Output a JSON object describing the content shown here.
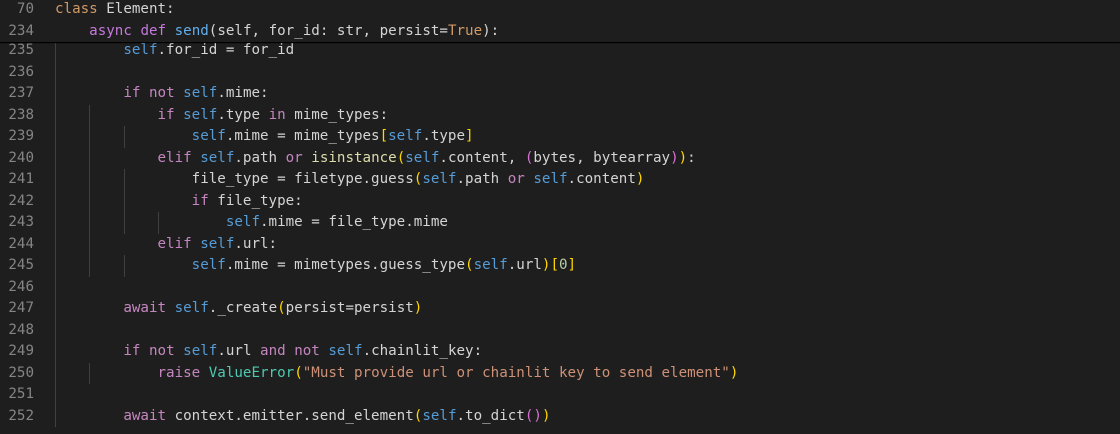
{
  "sticky": [
    {
      "num": "70",
      "tokens": [
        {
          "t": "class",
          "c": "sticky-kw"
        },
        {
          "t": " Element:",
          "c": "sticky-tx"
        }
      ]
    },
    {
      "num": "234",
      "tokens": [
        {
          "t": "    ",
          "c": "tx"
        },
        {
          "t": "async",
          "c": "sticky-kw2"
        },
        {
          "t": " ",
          "c": "tx"
        },
        {
          "t": "def",
          "c": "sticky-kw2"
        },
        {
          "t": " ",
          "c": "tx"
        },
        {
          "t": "send",
          "c": "sticky-fn"
        },
        {
          "t": "(self, for_id: str, persist=",
          "c": "sticky-tx"
        },
        {
          "t": "True",
          "c": "sticky-kw"
        },
        {
          "t": "):",
          "c": "sticky-tx"
        }
      ]
    }
  ],
  "lines": [
    {
      "num": "235",
      "guides": [
        1
      ],
      "tokens": [
        {
          "t": "        ",
          "c": "tx"
        },
        {
          "t": "self",
          "c": "self"
        },
        {
          "t": ".for_id = for_id",
          "c": "tx"
        }
      ]
    },
    {
      "num": "236",
      "guides": [
        1
      ],
      "tokens": []
    },
    {
      "num": "237",
      "guides": [
        1
      ],
      "tokens": [
        {
          "t": "        ",
          "c": "tx"
        },
        {
          "t": "if",
          "c": "ctl"
        },
        {
          "t": " ",
          "c": "tx"
        },
        {
          "t": "not",
          "c": "ctl"
        },
        {
          "t": " ",
          "c": "tx"
        },
        {
          "t": "self",
          "c": "self"
        },
        {
          "t": ".mime:",
          "c": "tx"
        }
      ]
    },
    {
      "num": "238",
      "guides": [
        1,
        2
      ],
      "tokens": [
        {
          "t": "            ",
          "c": "tx"
        },
        {
          "t": "if",
          "c": "ctl"
        },
        {
          "t": " ",
          "c": "tx"
        },
        {
          "t": "self",
          "c": "self"
        },
        {
          "t": ".type ",
          "c": "tx"
        },
        {
          "t": "in",
          "c": "ctl"
        },
        {
          "t": " mime_types:",
          "c": "tx"
        }
      ]
    },
    {
      "num": "239",
      "guides": [
        1,
        2,
        3
      ],
      "tokens": [
        {
          "t": "                ",
          "c": "tx"
        },
        {
          "t": "self",
          "c": "self"
        },
        {
          "t": ".mime = mime_types",
          "c": "tx"
        },
        {
          "t": "[",
          "c": "b1"
        },
        {
          "t": "self",
          "c": "self"
        },
        {
          "t": ".type",
          "c": "tx"
        },
        {
          "t": "]",
          "c": "b1"
        }
      ]
    },
    {
      "num": "240",
      "guides": [
        1,
        2
      ],
      "tokens": [
        {
          "t": "            ",
          "c": "tx"
        },
        {
          "t": "elif",
          "c": "ctl"
        },
        {
          "t": " ",
          "c": "tx"
        },
        {
          "t": "self",
          "c": "self"
        },
        {
          "t": ".path ",
          "c": "tx"
        },
        {
          "t": "or",
          "c": "ctl"
        },
        {
          "t": " ",
          "c": "tx"
        },
        {
          "t": "isinstance",
          "c": "fn"
        },
        {
          "t": "(",
          "c": "b1"
        },
        {
          "t": "self",
          "c": "self"
        },
        {
          "t": ".content, ",
          "c": "tx"
        },
        {
          "t": "(",
          "c": "b2"
        },
        {
          "t": "bytes, bytearray",
          "c": "tx"
        },
        {
          "t": ")",
          "c": "b2"
        },
        {
          "t": ")",
          "c": "b1"
        },
        {
          "t": ":",
          "c": "tx"
        }
      ]
    },
    {
      "num": "241",
      "guides": [
        1,
        2,
        3
      ],
      "tokens": [
        {
          "t": "                ",
          "c": "tx"
        },
        {
          "t": "file_type = filetype.guess",
          "c": "tx"
        },
        {
          "t": "(",
          "c": "b1"
        },
        {
          "t": "self",
          "c": "self"
        },
        {
          "t": ".path ",
          "c": "tx"
        },
        {
          "t": "or",
          "c": "ctl"
        },
        {
          "t": " ",
          "c": "tx"
        },
        {
          "t": "self",
          "c": "self"
        },
        {
          "t": ".content",
          "c": "tx"
        },
        {
          "t": ")",
          "c": "b1"
        }
      ]
    },
    {
      "num": "242",
      "guides": [
        1,
        2,
        3
      ],
      "tokens": [
        {
          "t": "                ",
          "c": "tx"
        },
        {
          "t": "if",
          "c": "ctl"
        },
        {
          "t": " file_type:",
          "c": "tx"
        }
      ]
    },
    {
      "num": "243",
      "guides": [
        1,
        2,
        3,
        4
      ],
      "tokens": [
        {
          "t": "                    ",
          "c": "tx"
        },
        {
          "t": "self",
          "c": "self"
        },
        {
          "t": ".mime = file_type.mime",
          "c": "tx"
        }
      ]
    },
    {
      "num": "244",
      "guides": [
        1,
        2
      ],
      "tokens": [
        {
          "t": "            ",
          "c": "tx"
        },
        {
          "t": "elif",
          "c": "ctl"
        },
        {
          "t": " ",
          "c": "tx"
        },
        {
          "t": "self",
          "c": "self"
        },
        {
          "t": ".url:",
          "c": "tx"
        }
      ]
    },
    {
      "num": "245",
      "guides": [
        1,
        2,
        3
      ],
      "tokens": [
        {
          "t": "                ",
          "c": "tx"
        },
        {
          "t": "self",
          "c": "self"
        },
        {
          "t": ".mime = mimetypes.guess_type",
          "c": "tx"
        },
        {
          "t": "(",
          "c": "b1"
        },
        {
          "t": "self",
          "c": "self"
        },
        {
          "t": ".url",
          "c": "tx"
        },
        {
          "t": ")",
          "c": "b1"
        },
        {
          "t": "[",
          "c": "b1"
        },
        {
          "t": "0",
          "c": "num"
        },
        {
          "t": "]",
          "c": "b1"
        }
      ]
    },
    {
      "num": "246",
      "guides": [
        1
      ],
      "tokens": []
    },
    {
      "num": "247",
      "guides": [
        1
      ],
      "tokens": [
        {
          "t": "        ",
          "c": "tx"
        },
        {
          "t": "await",
          "c": "ctl"
        },
        {
          "t": " ",
          "c": "tx"
        },
        {
          "t": "self",
          "c": "self"
        },
        {
          "t": "._create",
          "c": "tx"
        },
        {
          "t": "(",
          "c": "b1"
        },
        {
          "t": "persist=persist",
          "c": "tx"
        },
        {
          "t": ")",
          "c": "b1"
        }
      ]
    },
    {
      "num": "248",
      "guides": [
        1
      ],
      "tokens": []
    },
    {
      "num": "249",
      "guides": [
        1
      ],
      "tokens": [
        {
          "t": "        ",
          "c": "tx"
        },
        {
          "t": "if",
          "c": "ctl"
        },
        {
          "t": " ",
          "c": "tx"
        },
        {
          "t": "not",
          "c": "ctl"
        },
        {
          "t": " ",
          "c": "tx"
        },
        {
          "t": "self",
          "c": "self"
        },
        {
          "t": ".url ",
          "c": "tx"
        },
        {
          "t": "and",
          "c": "ctl"
        },
        {
          "t": " ",
          "c": "tx"
        },
        {
          "t": "not",
          "c": "ctl"
        },
        {
          "t": " ",
          "c": "tx"
        },
        {
          "t": "self",
          "c": "self"
        },
        {
          "t": ".chainlit_key:",
          "c": "tx"
        }
      ]
    },
    {
      "num": "250",
      "guides": [
        1,
        2
      ],
      "tokens": [
        {
          "t": "            ",
          "c": "tx"
        },
        {
          "t": "raise",
          "c": "ctl"
        },
        {
          "t": " ",
          "c": "tx"
        },
        {
          "t": "ValueError",
          "c": "cls"
        },
        {
          "t": "(",
          "c": "b1"
        },
        {
          "t": "\"Must provide url or chainlit key to send element\"",
          "c": "str"
        },
        {
          "t": ")",
          "c": "b1"
        }
      ]
    },
    {
      "num": "251",
      "guides": [
        1
      ],
      "tokens": []
    },
    {
      "num": "252",
      "guides": [
        1
      ],
      "tokens": [
        {
          "t": "        ",
          "c": "tx"
        },
        {
          "t": "await",
          "c": "ctl"
        },
        {
          "t": " context.emitter.send_element",
          "c": "tx"
        },
        {
          "t": "(",
          "c": "b1"
        },
        {
          "t": "self",
          "c": "self"
        },
        {
          "t": ".to_dict",
          "c": "tx"
        },
        {
          "t": "(",
          "c": "b2"
        },
        {
          "t": ")",
          "c": "b2"
        },
        {
          "t": ")",
          "c": "b1"
        }
      ]
    }
  ]
}
